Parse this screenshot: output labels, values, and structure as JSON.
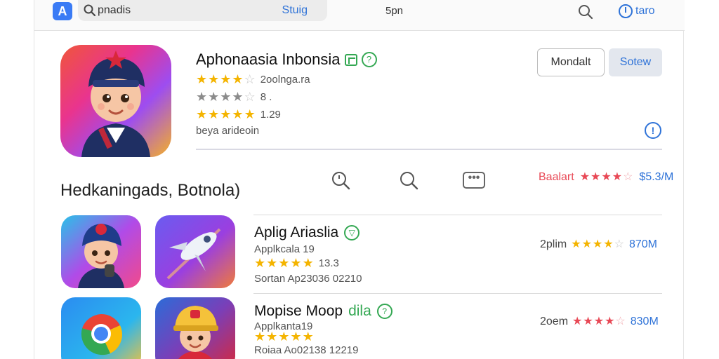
{
  "topbar": {
    "logo_letter": "A",
    "search_query": "pnadis",
    "search_action": "Stuig",
    "center_text": "5pn",
    "account_label": "taro"
  },
  "featured": {
    "title": "Aphonaasia Inbonsia",
    "rating_rows": [
      {
        "stars": 4,
        "text": "2oolnga.ra"
      },
      {
        "stars": 4,
        "text": "8 ."
      },
      {
        "stars": 4.5,
        "text": "1.29"
      }
    ],
    "subtitle": "beya arideoin",
    "buttons": {
      "secondary": "Mondalt",
      "primary": "Sotew"
    }
  },
  "section": {
    "title": "Hedkaningads, Botnola)",
    "meta_label": "Baalart",
    "meta_size": "$5.3/M",
    "meta_stars": 3.5
  },
  "list": [
    {
      "title": "Aplig Ariaslia",
      "category": "Applkcala 19",
      "stars": 4.5,
      "rating": "13.3",
      "detail": "Sortan Ap23036 02210",
      "right_label": "2plim",
      "right_stars": 4,
      "right_star_color": "gold",
      "size": "870M"
    },
    {
      "title": "Mopise Moop",
      "title_suffix": "dila",
      "category": "Applkanta19",
      "stars": 4.5,
      "rating": "",
      "detail": "Roiaa Ao02138 12219",
      "right_label": "2oem",
      "right_stars": 4,
      "right_star_color": "red",
      "size": "830M"
    }
  ],
  "colors": {
    "accent": "#2f73d8",
    "star": "#f4b400",
    "red": "#e84855",
    "verified": "#34a853"
  }
}
